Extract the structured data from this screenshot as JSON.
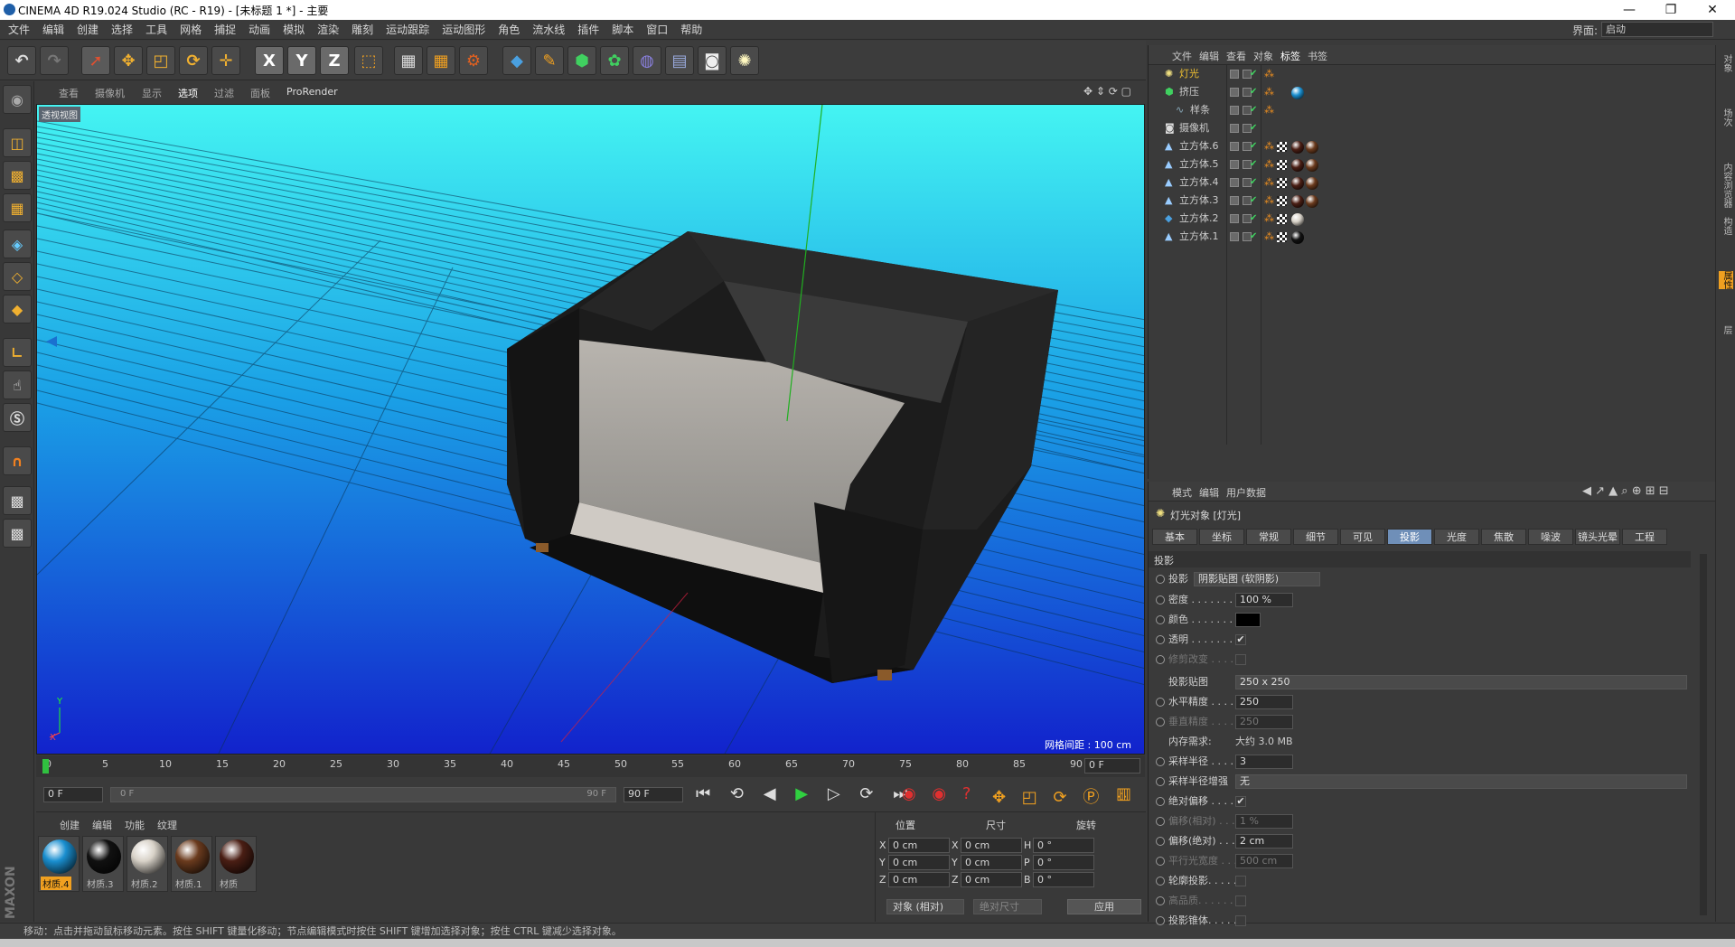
{
  "window": {
    "title": "CINEMA 4D R19.024 Studio (RC - R19) - [未标题 1 *] - 主要",
    "minimize": "—",
    "maximize": "❐",
    "close": "✕"
  },
  "menu": {
    "items": [
      "文件",
      "编辑",
      "创建",
      "选择",
      "工具",
      "网格",
      "捕捉",
      "动画",
      "模拟",
      "渲染",
      "雕刻",
      "运动跟踪",
      "运动图形",
      "角色",
      "流水线",
      "插件",
      "脚本",
      "窗口",
      "帮助"
    ],
    "layout_label": "界面:",
    "layout_value": "启动"
  },
  "toolbar": {
    "icons": [
      "undo-icon",
      "redo-icon",
      "select-arrow-icon",
      "move-icon",
      "scale-icon",
      "rotate-icon",
      "transform-icon",
      "x-axis-icon",
      "y-axis-icon",
      "z-axis-icon",
      "world-coord-icon",
      "render-view-icon",
      "render-picture-viewer-icon",
      "render-settings-icon",
      "cube-primitive-icon",
      "pen-spline-icon",
      "subdivision-icon",
      "cloner-icon",
      "deformer-icon",
      "floor-icon",
      "camera-icon",
      "light-icon"
    ],
    "x_label": "X",
    "y_label": "Y",
    "z_label": "Z"
  },
  "viewport": {
    "menus": [
      "查看",
      "摄像机",
      "显示",
      "选项",
      "过滤",
      "面板",
      "ProRender"
    ],
    "label": "透视视图",
    "grid_info": "网格间距 : 100 cm",
    "axis_y": "Y",
    "axis_x": "X"
  },
  "timeline": {
    "ticks": [
      "0",
      "5",
      "10",
      "15",
      "20",
      "25",
      "30",
      "35",
      "40",
      "45",
      "50",
      "55",
      "60",
      "65",
      "70",
      "75",
      "80",
      "85",
      "90"
    ],
    "end_frame": "0 F"
  },
  "transport": {
    "start": "0 F",
    "slider_start": "0 F",
    "slider_end": "90 F",
    "end": "90 F"
  },
  "materials": {
    "menus": [
      "创建",
      "编辑",
      "功能",
      "纹理"
    ],
    "items": [
      {
        "name": "材质.4",
        "color": "#1a8fd0",
        "selected": true
      },
      {
        "name": "材质.3",
        "color": "#111111",
        "selected": false
      },
      {
        "name": "材质.2",
        "color": "#d8d2c8",
        "selected": false
      },
      {
        "name": "材质.1",
        "color": "#6b3b1e",
        "selected": false
      },
      {
        "name": "材质",
        "color": "#4a1e14",
        "selected": false
      }
    ]
  },
  "coords": {
    "headers": [
      "位置",
      "尺寸",
      "旋转"
    ],
    "rows": [
      {
        "a": "X",
        "pos": "0 cm",
        "b": "X",
        "size": "0 cm",
        "c": "H",
        "rot": "0 °"
      },
      {
        "a": "Y",
        "pos": "0 cm",
        "b": "Y",
        "size": "0 cm",
        "c": "P",
        "rot": "0 °"
      },
      {
        "a": "Z",
        "pos": "0 cm",
        "b": "Z",
        "size": "0 cm",
        "c": "B",
        "rot": "0 °"
      }
    ],
    "mode": "对象 (相对)",
    "size_mode": "绝对尺寸",
    "apply": "应用"
  },
  "status": "移动：点击并拖动鼠标移动元素。按住 SHIFT 键量化移动；节点编辑模式时按住 SHIFT 键增加选择对象；按住 CTRL 键减少选择对象。",
  "objects": {
    "menus": [
      "文件",
      "编辑",
      "查看",
      "对象",
      "标签",
      "书签"
    ],
    "rows": [
      {
        "name": "灯光",
        "icon": "light-icon",
        "indent": 0,
        "highlight": true,
        "tags": []
      },
      {
        "name": "挤压",
        "icon": "extrude-icon",
        "indent": 0,
        "highlight": false,
        "tags": [
          "#1a8fd0"
        ]
      },
      {
        "name": "样条",
        "icon": "spline-icon",
        "indent": 1,
        "highlight": false,
        "tags": []
      },
      {
        "name": "摄像机",
        "icon": "camera-icon",
        "indent": 0,
        "highlight": false,
        "tags": []
      },
      {
        "name": "立方体.6",
        "icon": "polygon-icon",
        "indent": 0,
        "highlight": false,
        "tags": [
          "#4a1e14",
          "#6b3b1e"
        ]
      },
      {
        "name": "立方体.5",
        "icon": "polygon-icon",
        "indent": 0,
        "highlight": false,
        "tags": [
          "#4a1e14",
          "#6b3b1e"
        ]
      },
      {
        "name": "立方体.4",
        "icon": "polygon-icon",
        "indent": 0,
        "highlight": false,
        "tags": [
          "#4a1e14",
          "#6b3b1e"
        ]
      },
      {
        "name": "立方体.3",
        "icon": "polygon-icon",
        "indent": 0,
        "highlight": false,
        "tags": [
          "#4a1e14",
          "#6b3b1e"
        ]
      },
      {
        "name": "立方体.2",
        "icon": "cube-icon",
        "indent": 0,
        "highlight": false,
        "tags": [
          "#d8d2c8"
        ]
      },
      {
        "name": "立方体.1",
        "icon": "polygon-icon",
        "indent": 0,
        "highlight": false,
        "tags": [
          "#111111"
        ]
      }
    ]
  },
  "attributes": {
    "menus": [
      "模式",
      "编辑",
      "用户数据"
    ],
    "object_title": "灯光对象 [灯光]",
    "tabs": [
      "基本",
      "坐标",
      "常规",
      "细节",
      "可见",
      "投影",
      "光度",
      "焦散",
      "噪波",
      "镜头光晕",
      "工程"
    ],
    "active_tab": "投影",
    "section": "投影",
    "rows": [
      {
        "label": "投影",
        "value": "阴影贴图 (软阴影)",
        "kind": "dropdown",
        "dim": false
      },
      {
        "label": "密度 . . . . . . .",
        "value": "100 %",
        "kind": "spin",
        "dim": false
      },
      {
        "label": "颜色 . . . . . . .",
        "value": "",
        "kind": "color",
        "dim": false
      },
      {
        "label": "透明 . . . . . . .",
        "value": "✔",
        "kind": "check",
        "dim": false
      },
      {
        "label": "修剪改变 . . . .",
        "value": "",
        "kind": "check",
        "dim": true
      },
      {
        "label": "投影贴图",
        "value": "250 x 250",
        "kind": "wide",
        "dim": false
      },
      {
        "label": "水平精度 . . . .",
        "value": "250",
        "kind": "spin",
        "dim": false
      },
      {
        "label": "垂直精度 . . . .",
        "value": "250",
        "kind": "spin",
        "dim": true
      },
      {
        "label": "内存需求:",
        "value": "大约 3.0 MB",
        "kind": "text",
        "dim": false
      },
      {
        "label": "采样半径 . . . .",
        "value": "3",
        "kind": "spin",
        "dim": false
      },
      {
        "label": "采样半径增强",
        "value": "无",
        "kind": "wide",
        "dim": false
      },
      {
        "label": "绝对偏移 . . . .",
        "value": "✔",
        "kind": "check",
        "dim": false
      },
      {
        "label": "偏移(相对) . . .",
        "value": "1 %",
        "kind": "spin",
        "dim": true
      },
      {
        "label": "偏移(绝对) . . .",
        "value": "2 cm",
        "kind": "spin",
        "dim": false
      },
      {
        "label": "平行光宽度 . . .",
        "value": "500 cm",
        "kind": "spin",
        "dim": true
      },
      {
        "label": "轮廓投影. . . . .",
        "value": "",
        "kind": "check",
        "dim": false
      },
      {
        "label": "高品质. . . . . . .",
        "value": "",
        "kind": "check",
        "dim": true
      },
      {
        "label": "投影锥体. . . . .",
        "value": "",
        "kind": "check",
        "dim": false
      }
    ]
  },
  "right_tabs": [
    "对象",
    "场次",
    "内容浏览器",
    "构造",
    "属性",
    "层"
  ],
  "colors": {
    "accent": "#6f8fb8",
    "highlight_text": "#f0c030",
    "viewport_top": "#3ff0f0",
    "viewport_bottom": "#1020d0"
  }
}
